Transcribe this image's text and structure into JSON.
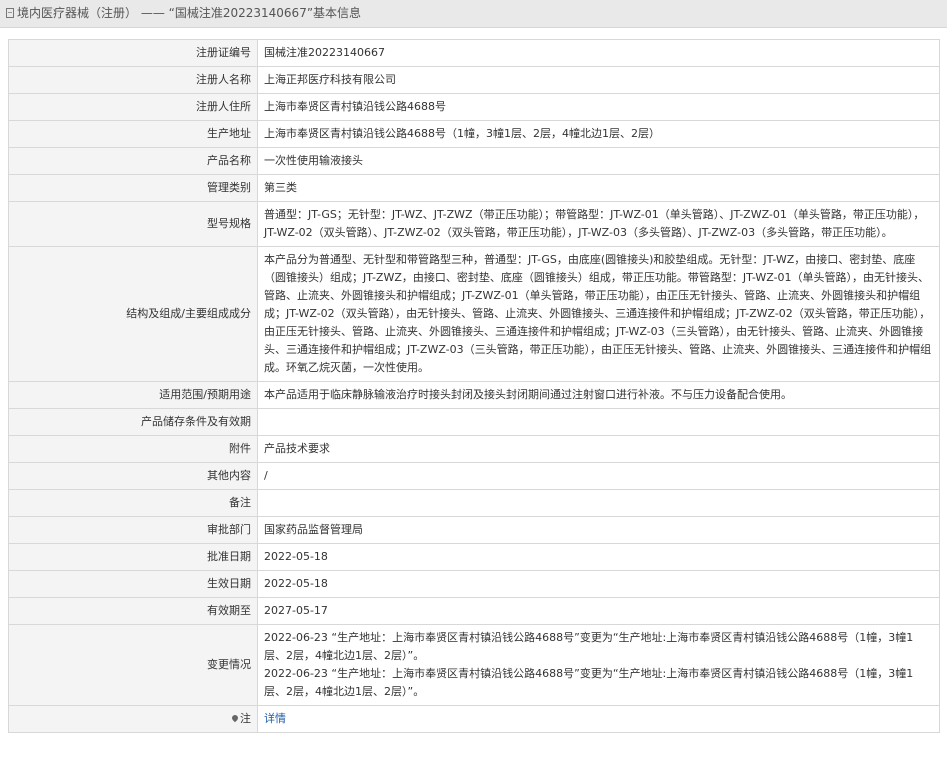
{
  "header": {
    "title": "境内医疗器械（注册） —— “国械注准20223140667”基本信息",
    "icon": "document-icon"
  },
  "rows": [
    {
      "label": "注册证编号",
      "value": "国械注准20223140667"
    },
    {
      "label": "注册人名称",
      "value": "上海正邦医疗科技有限公司"
    },
    {
      "label": "注册人住所",
      "value": "上海市奉贤区青村镇沿钱公路4688号"
    },
    {
      "label": "生产地址",
      "value": "上海市奉贤区青村镇沿钱公路4688号（1幢，3幢1层、2层，4幢北边1层、2层）"
    },
    {
      "label": "产品名称",
      "value": "一次性使用输液接头"
    },
    {
      "label": "管理类别",
      "value": "第三类"
    },
    {
      "label": "型号规格",
      "value": "普通型：JT-GS；无针型：JT-WZ、JT-ZWZ（带正压功能）；带管路型：JT-WZ-01（单头管路）、JT-ZWZ-01（单头管路，带正压功能），JT-WZ-02（双头管路）、JT-ZWZ-02（双头管路，带正压功能），JT-WZ-03（多头管路）、JT-ZWZ-03（多头管路，带正压功能）。"
    },
    {
      "label": "结构及组成/主要组成成分",
      "value": "本产品分为普通型、无针型和带管路型三种，普通型：JT-GS，由底座(圆锥接头)和胶垫组成。无针型：JT-WZ，由接口、密封垫、底座（圆锥接头）组成；JT-ZWZ，由接口、密封垫、底座（圆锥接头）组成，带正压功能。带管路型：JT-WZ-01（单头管路），由无针接头、管路、止流夹、外圆锥接头和护帽组成；JT-ZWZ-01（单头管路，带正压功能），由正压无针接头、管路、止流夹、外圆锥接头和护帽组成；JT-WZ-02（双头管路），由无针接头、管路、止流夹、外圆锥接头、三通连接件和护帽组成；JT-ZWZ-02（双头管路，带正压功能），由正压无针接头、管路、止流夹、外圆锥接头、三通连接件和护帽组成；JT-WZ-03（三头管路），由无针接头、管路、止流夹、外圆锥接头、三通连接件和护帽组成；JT-ZWZ-03（三头管路，带正压功能），由正压无针接头、管路、止流夹、外圆锥接头、三通连接件和护帽组成。环氧乙烷灭菌，一次性使用。"
    },
    {
      "label": "适用范围/预期用途",
      "value": "本产品适用于临床静脉输液治疗时接头封闭及接头封闭期间通过注射窗口进行补液。不与压力设备配合使用。"
    },
    {
      "label": "产品储存条件及有效期",
      "value": ""
    },
    {
      "label": "附件",
      "value": "产品技术要求"
    },
    {
      "label": "其他内容",
      "value": "/"
    },
    {
      "label": "备注",
      "value": ""
    },
    {
      "label": "审批部门",
      "value": "国家药品监督管理局"
    },
    {
      "label": "批准日期",
      "value": "2022-05-18"
    },
    {
      "label": "生效日期",
      "value": "2022-05-18"
    },
    {
      "label": "有效期至",
      "value": "2027-05-17"
    }
  ],
  "changes": {
    "label": "变更情况",
    "lines": [
      "2022-06-23 “生产地址：上海市奉贤区青村镇沿钱公路4688号”变更为“生产地址:上海市奉贤区青村镇沿钱公路4688号（1幢，3幢1层、2层，4幢北边1层、2层）”。",
      "2022-06-23 “生产地址：上海市奉贤区青村镇沿钱公路4688号”变更为“生产地址:上海市奉贤区青村镇沿钱公路4688号（1幢，3幢1层、2层，4幢北边1层、2层）”。"
    ]
  },
  "note": {
    "label": "注",
    "icon": "location-pin-icon",
    "link_text": "详情"
  }
}
